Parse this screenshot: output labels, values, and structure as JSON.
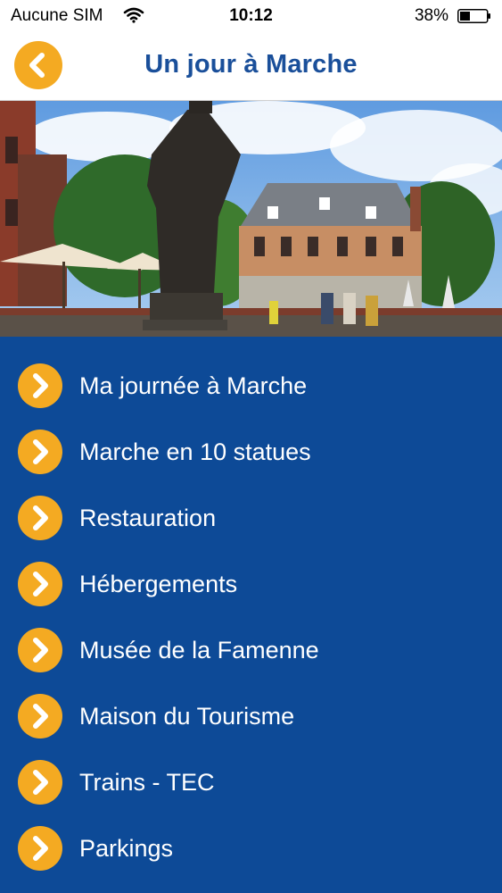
{
  "status_bar": {
    "carrier": "Aucune SIM",
    "time": "10:12",
    "battery": "38%"
  },
  "nav": {
    "title": "Un jour à Marche",
    "back_icon": "chevron-left-icon"
  },
  "colors": {
    "accent": "#f4aa22",
    "menu_background": "#0d4a97",
    "title": "#1a4f9a",
    "label": "#ffffff"
  },
  "menu": {
    "items": [
      {
        "label": "Ma journée à Marche"
      },
      {
        "label": "Marche en 10 statues"
      },
      {
        "label": "Restauration"
      },
      {
        "label": "Hébergements"
      },
      {
        "label": "Musée de la Famenne"
      },
      {
        "label": "Maison du Tourisme"
      },
      {
        "label": "Trains - TEC"
      },
      {
        "label": "Parkings"
      }
    ]
  }
}
